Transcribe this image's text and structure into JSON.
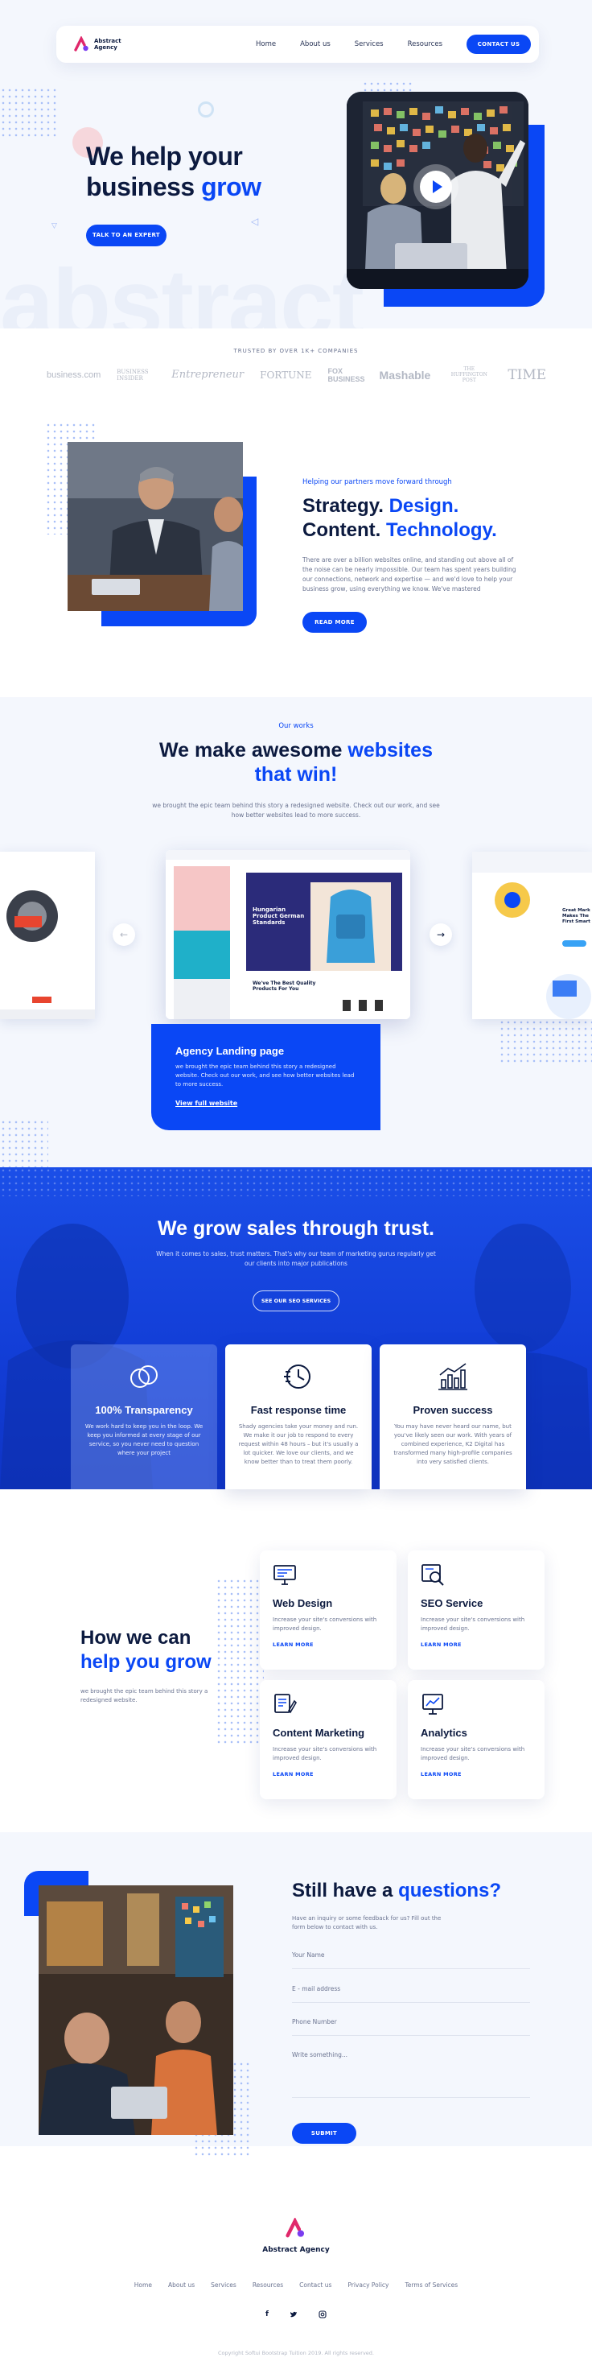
{
  "brand": {
    "name_line1": "Abstract",
    "name_line2": "Agency",
    "footer_name": "Abstract Agency",
    "accent": "#0a47f5",
    "logo_color": "#e0286b"
  },
  "nav": {
    "items": [
      "Home",
      "About us",
      "Services",
      "Resources"
    ],
    "cta": "CONTACT US"
  },
  "hero": {
    "title_line1": "We help your",
    "title_line2_plain": "business ",
    "title_line2_accent": "grow",
    "cta": "TALK TO AN EXPERT",
    "watermark": "abstract"
  },
  "trusted": {
    "label": "TRUSTED BY OVER 1K+ COMPANIES",
    "brands": [
      "business.com",
      "BUSINESS INSIDER",
      "Entrepreneur",
      "FORTUNE",
      "FOX BUSINESS",
      "Mashable",
      "THE HUFFINGTON POST",
      "TIME"
    ]
  },
  "strategy": {
    "kicker": "Helping our partners move forward through",
    "h_plain1": "Strategy. ",
    "h_accent1": "Design.",
    "h_plain2": "Content. ",
    "h_accent2": "Technology.",
    "body": "There are over a billion websites online, and standing out above all of the noise can be nearly impossible. Our team has spent years building our connections, network and expertise — and we'd love to help your business grow, using everything we know. We've mastered",
    "cta": "READ MORE"
  },
  "works": {
    "kicker": "Our works",
    "h_plain1": "We make awesome ",
    "h_accent1": "websites",
    "h_accent2": "that win!",
    "body": "we brought the epic team behind this story a redesigned website. Check out our work, and see how better websites lead to more success.",
    "card_title": "Agency Landing page",
    "card_body": "we brought the epic team behind this story a redesigned website. Check out our work, and see how better websites lead to more success.",
    "card_link": "View full website",
    "mock_heading": "Hungarian Product German Standards",
    "mock_sub": "We've The Best Quality Products For You",
    "mock_right": "Great Mark Makes The First Smart",
    "prev": "←",
    "next": "→"
  },
  "trust": {
    "title": "We grow sales through trust.",
    "body": "When it comes to sales, trust matters. That's why our team of marketing gurus regularly get our clients into major publications",
    "cta": "SEE OUR SEO SERVICES",
    "cards": [
      {
        "title": "100% Transparency",
        "body": "We work hard to keep you in the loop. We keep you informed at every stage of our service, so you never need to question where your project"
      },
      {
        "title": "Fast response time",
        "body": "Shady agencies take your money and run. We make it our job to respond to every request within 48 hours – but it's usually a lot quicker. We love our clients, and we know better than to treat them poorly."
      },
      {
        "title": "Proven success",
        "body": "You may have never heard our name, but you've likely seen our work. With years of combined experience, K2 Digital has transformed many high-profile companies into very satisfied clients."
      }
    ]
  },
  "services": {
    "h_plain": "How we can",
    "h_accent": "help you grow",
    "body": "we brought the epic team behind this story a redesigned website.",
    "cards": [
      {
        "title": "Web Design",
        "body": "Increase your site's conversions with improved design.",
        "link": "LEARN MORE",
        "icon": "monitor-icon"
      },
      {
        "title": "SEO Service",
        "body": "Increase your site's conversions with improved design.",
        "link": "LEARN MORE",
        "icon": "seo-icon"
      },
      {
        "title": "Content Marketing",
        "body": "Increase your site's conversions with improved design.",
        "link": "LEARN MORE",
        "icon": "content-icon"
      },
      {
        "title": "Analytics",
        "body": "Increase your site's conversions with improved design.",
        "link": "LEARN MORE",
        "icon": "analytics-icon"
      }
    ]
  },
  "contact": {
    "h_plain": "Still have a ",
    "h_accent": "questions?",
    "body": "Have an inquiry or some feedback for us? Fill out the form below to contact with us.",
    "fields": [
      "Your Name",
      "E - mail address",
      "Phone Number",
      "Write something..."
    ],
    "submit": "SUBMIT"
  },
  "footer": {
    "links": [
      "Home",
      "About us",
      "Services",
      "Resources",
      "Contact us",
      "Privacy Policy",
      "Terms of Services"
    ],
    "social": [
      "f",
      "t",
      "ig"
    ],
    "copyright": "Copyright Softui Bootstrap Tuition 2019. All rights reserved."
  }
}
